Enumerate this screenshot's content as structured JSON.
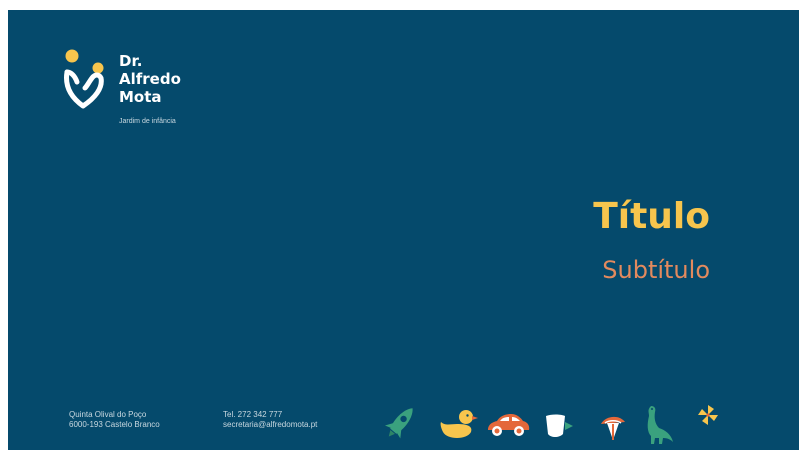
{
  "logo": {
    "line1": "Dr.",
    "line2": "Alfredo",
    "line3": "Mota",
    "tagline": "Jardim de infância",
    "icon": "heart-person-icon"
  },
  "slide": {
    "title": "Título",
    "subtitle": "Subtítulo"
  },
  "footer": {
    "address_line1": "Quinta Olival do Poço",
    "address_line2": "6000-193 Castelo Branco",
    "phone": "Tel. 272 342 777",
    "email": "secretaria@alfredomota.pt"
  },
  "icons": [
    "rocket-icon",
    "duck-icon",
    "car-icon",
    "cup-icon",
    "beach-ball-icon",
    "dinosaur-icon",
    "pinwheel-icon"
  ],
  "colors": {
    "background": "#054a6c",
    "title": "#f7c54d",
    "subtitle": "#e38a5e",
    "green": "#3aa17e",
    "yellow": "#f7c54d",
    "orange": "#e4683a",
    "white": "#ffffff"
  }
}
